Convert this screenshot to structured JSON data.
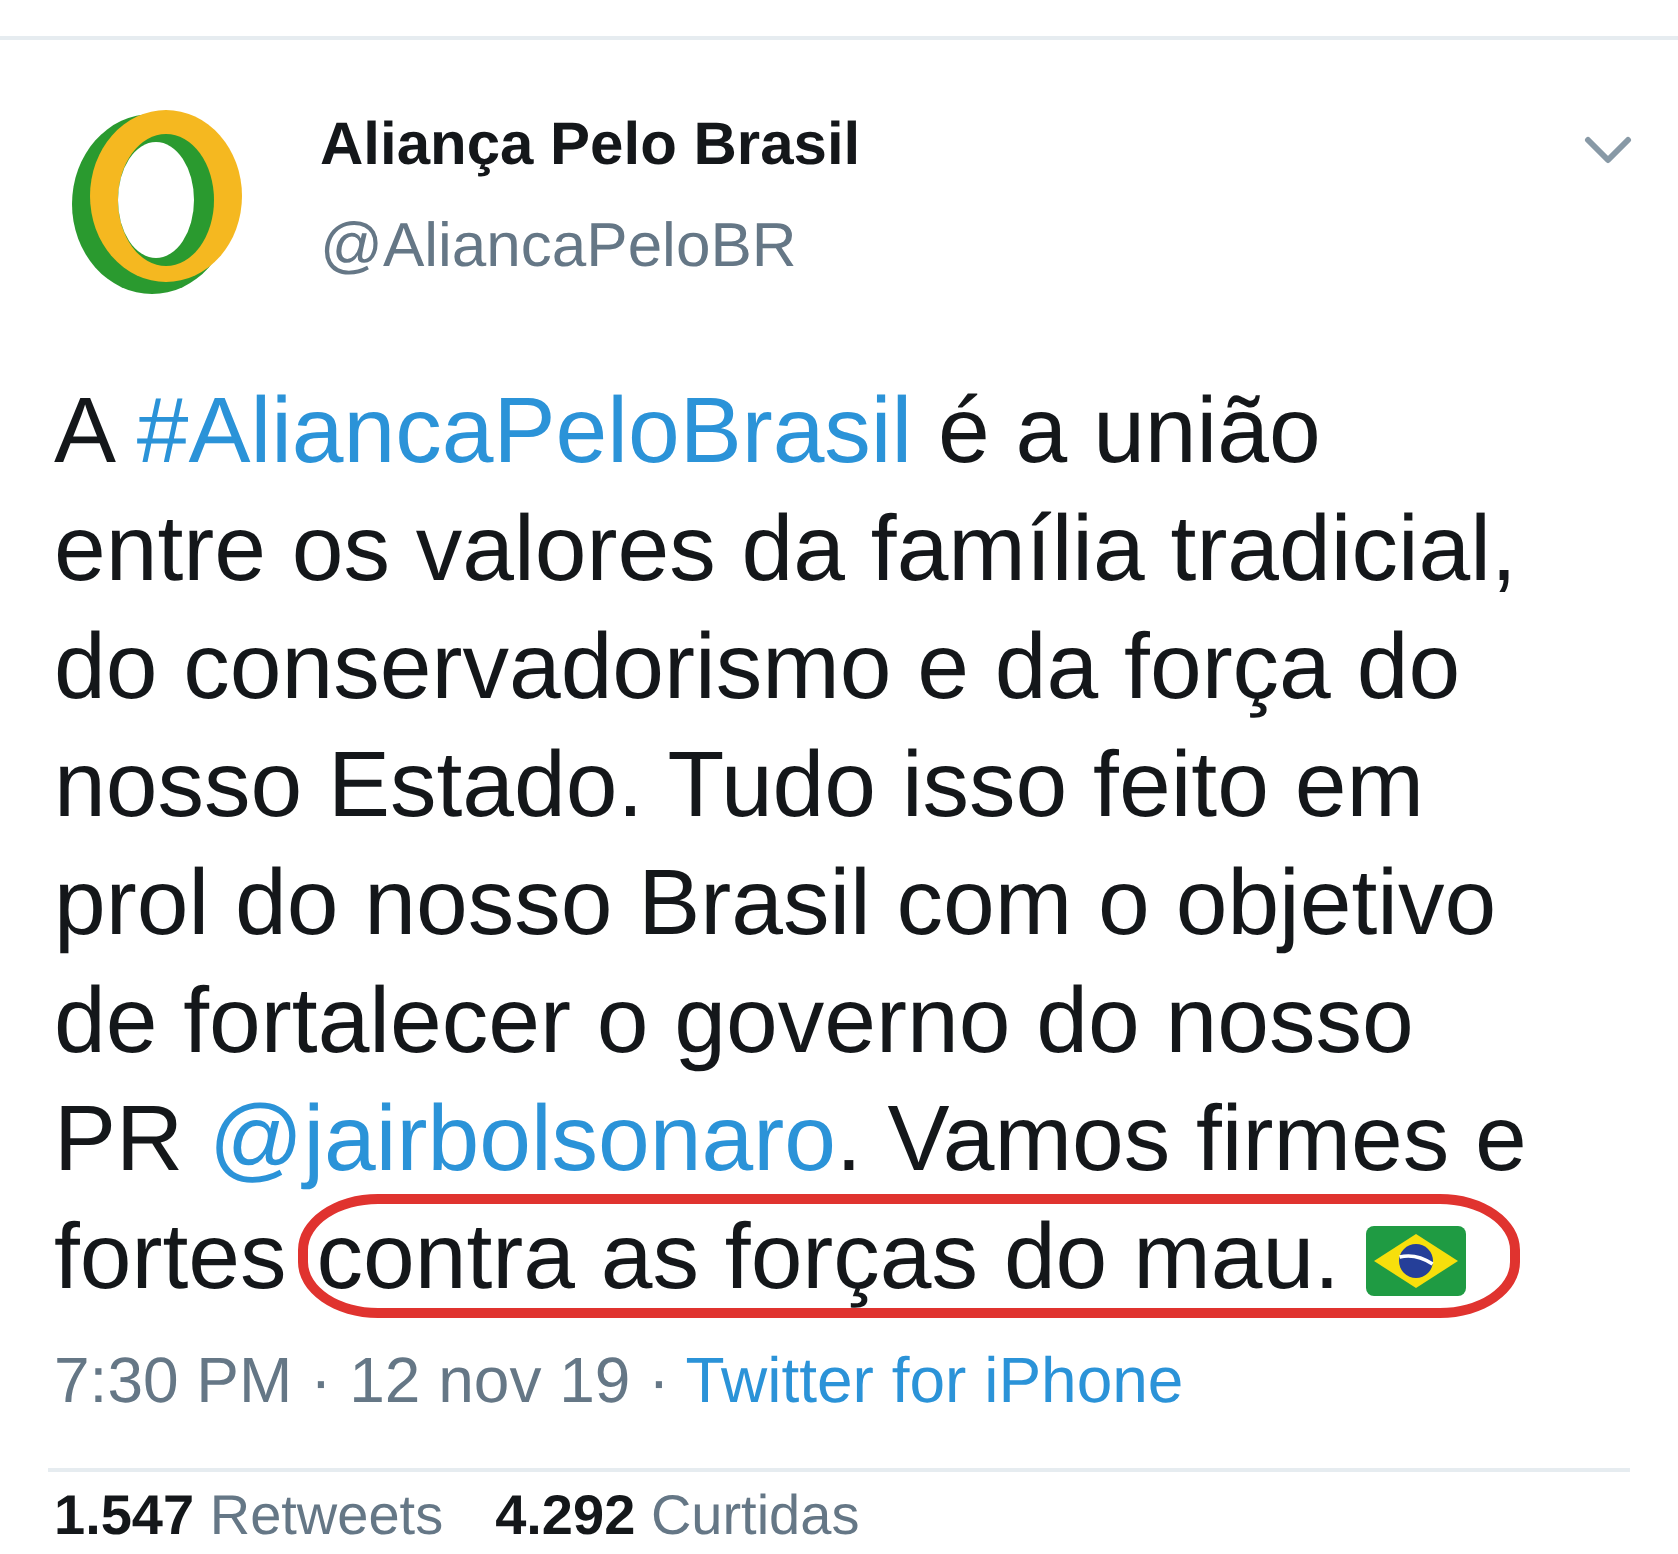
{
  "tweet": {
    "author": {
      "name": "Aliança Pelo Brasil",
      "handle": "@AliancaPeloBR"
    },
    "text": [
      {
        "kind": "text",
        "text": "A ",
        "circled": false
      },
      {
        "kind": "hashtag",
        "text": "#AliancaPeloBrasil",
        "circled": false
      },
      {
        "kind": "text",
        "text": " é a união\nentre os valores da família tradicial,\ndo conservadorismo e da força do\nnosso Estado. Tudo isso feito em\nprol do nosso Brasil com o objetivo\nde fortalecer o governo do nosso\nPR ",
        "circled": false
      },
      {
        "kind": "mention",
        "text": "@jairbolsonaro",
        "circled": false
      },
      {
        "kind": "text",
        "text": ". Vamos firmes e\nfortes ",
        "circled": false
      },
      {
        "kind": "text",
        "text": "contra as forças do mau. ",
        "circled": true
      }
    ],
    "timestamp": "7:30 PM · 12 nov 19 ·",
    "source": "Twitter for iPhone"
  },
  "stats": [
    {
      "count": "1.547",
      "label": "Retweets"
    },
    {
      "count": "4.292",
      "label": "Curtidas"
    }
  ]
}
